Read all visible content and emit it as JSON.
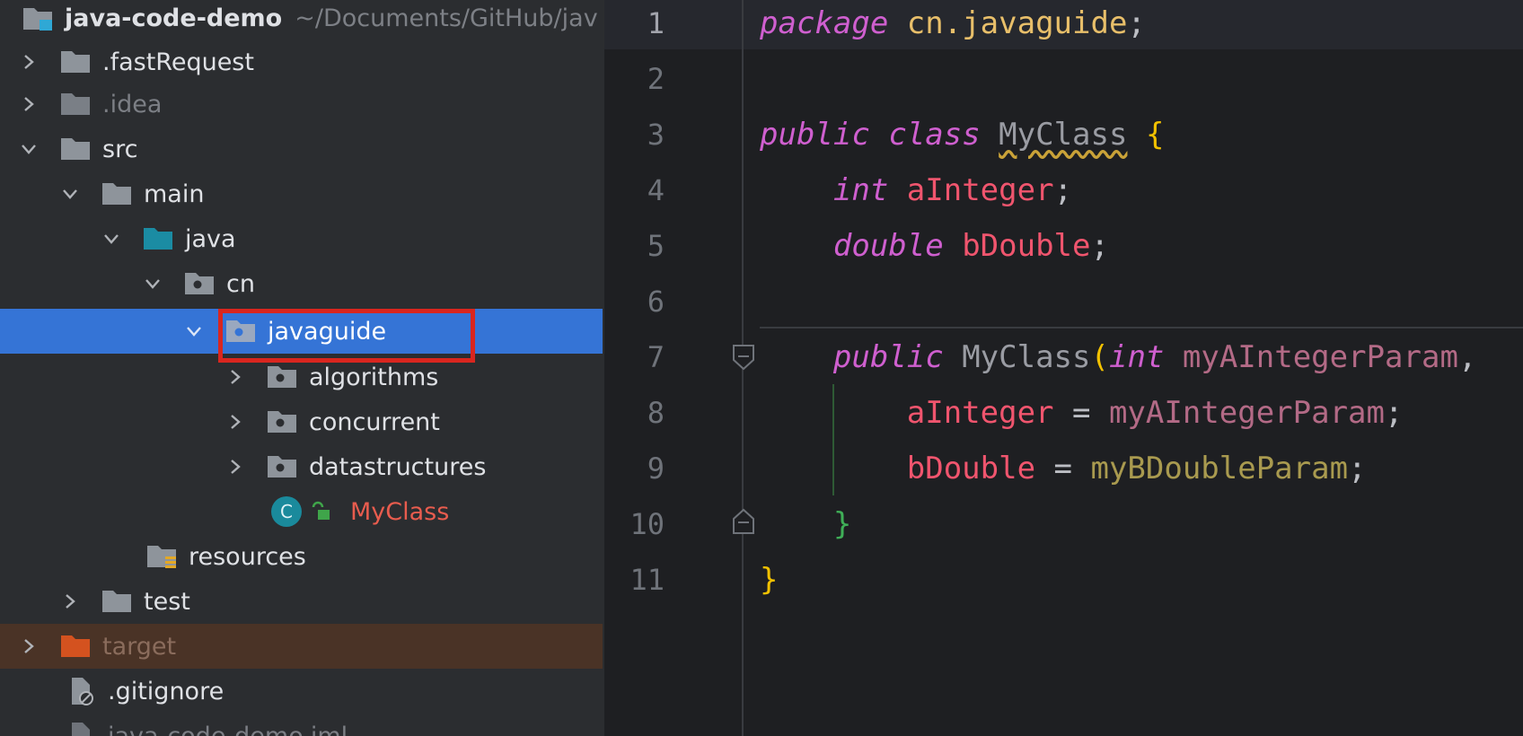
{
  "project": {
    "root": {
      "label": "java-code-demo",
      "path": "~/Documents/GitHub/jav"
    },
    "items": [
      {
        "label": ".fastRequest",
        "kind": "folder"
      },
      {
        "label": ".idea",
        "kind": "folder"
      },
      {
        "label": "src",
        "kind": "folder"
      },
      {
        "label": "main",
        "kind": "folder"
      },
      {
        "label": "java",
        "kind": "source-root"
      },
      {
        "label": "cn",
        "kind": "package"
      },
      {
        "label": "javaguide",
        "kind": "package",
        "selected": true
      },
      {
        "label": "algorithms",
        "kind": "package"
      },
      {
        "label": "concurrent",
        "kind": "package"
      },
      {
        "label": "datastructures",
        "kind": "package"
      },
      {
        "label": "MyClass",
        "kind": "class",
        "icon_letter": "C"
      },
      {
        "label": "resources",
        "kind": "resources-root"
      },
      {
        "label": "test",
        "kind": "folder"
      },
      {
        "label": "target",
        "kind": "excluded-folder"
      },
      {
        "label": ".gitignore",
        "kind": "ignore-file"
      },
      {
        "label": "java-code-demo.iml",
        "kind": "module-file"
      }
    ]
  },
  "editor": {
    "line_numbers": [
      "1",
      "2",
      "3",
      "4",
      "5",
      "6",
      "7",
      "8",
      "9",
      "10",
      "11"
    ],
    "code": {
      "l1": {
        "kw": "package",
        "pkg": "cn.javaguide",
        "end": ";"
      },
      "l3": {
        "kw1": "public",
        "kw2": "class",
        "cls": "MyClass",
        "brace": "{"
      },
      "l4": {
        "kw": "int",
        "fld": "aInteger",
        "end": ";"
      },
      "l5": {
        "kw": "double",
        "fld": "bDouble",
        "end": ";"
      },
      "l7": {
        "kw": "public",
        "cls": "MyClass",
        "paren": "(",
        "kw2": "int",
        "param": "myAIntegerParam",
        "end": ","
      },
      "l8": {
        "fld": "aInteger",
        "op": " = ",
        "param": "myAIntegerParam",
        "end": ";"
      },
      "l9": {
        "fld": "bDouble",
        "op": " = ",
        "param": "myBDoubleParam",
        "end": ";"
      },
      "l10": {
        "brace": "}"
      },
      "l11": {
        "brace": "}"
      }
    }
  },
  "colors": {
    "selection": "#3574d6",
    "highlight_box": "#d9261f",
    "keyword": "#cf5fcf",
    "field": "#f0556e"
  }
}
